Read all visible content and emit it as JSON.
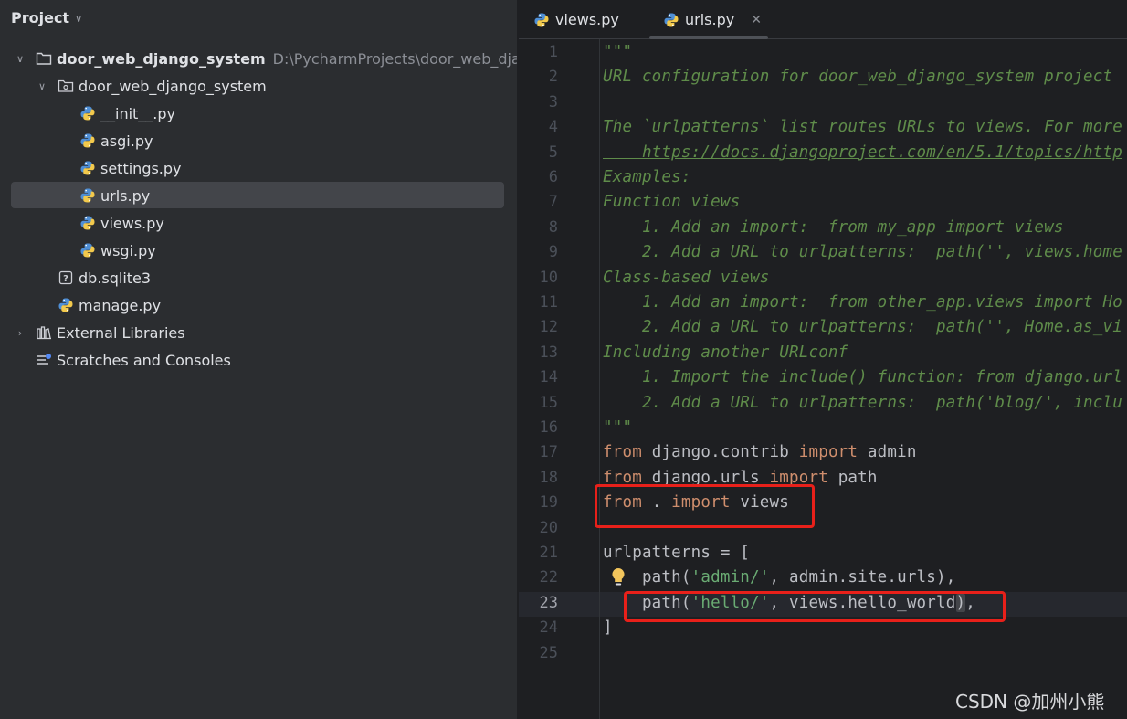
{
  "project_panel": {
    "title": "Project",
    "tree": [
      {
        "label": "door_web_django_system",
        "path": "D:\\PycharmProjects\\door_web_django",
        "icon": "folder-icon",
        "expanded": true
      },
      {
        "label": "door_web_django_system",
        "icon": "package-folder-icon",
        "expanded": true
      },
      {
        "label": "__init__.py",
        "icon": "python-file-icon"
      },
      {
        "label": "asgi.py",
        "icon": "python-file-icon"
      },
      {
        "label": "settings.py",
        "icon": "python-file-icon"
      },
      {
        "label": "urls.py",
        "icon": "python-file-icon",
        "selected": true
      },
      {
        "label": "views.py",
        "icon": "python-file-icon"
      },
      {
        "label": "wsgi.py",
        "icon": "python-file-icon"
      },
      {
        "label": "db.sqlite3",
        "icon": "unknown-file-icon"
      },
      {
        "label": "manage.py",
        "icon": "python-file-icon"
      },
      {
        "label": "External Libraries",
        "icon": "library-icon",
        "expanded": false
      },
      {
        "label": "Scratches and Consoles",
        "icon": "scratches-icon"
      }
    ]
  },
  "editor": {
    "tabs": [
      {
        "label": "views.py",
        "active": false
      },
      {
        "label": "urls.py",
        "active": true
      }
    ],
    "current_line": 23,
    "lines": [
      {
        "n": "1",
        "t": "\"\"\""
      },
      {
        "n": "2",
        "t": "URL configuration for door_web_django_system project"
      },
      {
        "n": "3",
        "t": ""
      },
      {
        "n": "4",
        "t": "The `urlpatterns` list routes URLs to views. For more"
      },
      {
        "n": "5",
        "t": "    https://docs.djangoproject.com/en/5.1/topics/http"
      },
      {
        "n": "6",
        "t": "Examples:"
      },
      {
        "n": "7",
        "t": "Function views"
      },
      {
        "n": "8",
        "t": "    1. Add an import:  from my_app import views"
      },
      {
        "n": "9",
        "t": "    2. Add a URL to urlpatterns:  path('', views.home"
      },
      {
        "n": "10",
        "t": "Class-based views"
      },
      {
        "n": "11",
        "t": "    1. Add an import:  from other_app.views import Ho"
      },
      {
        "n": "12",
        "t": "    2. Add a URL to urlpatterns:  path('', Home.as_vi"
      },
      {
        "n": "13",
        "t": "Including another URLconf"
      },
      {
        "n": "14",
        "t": "    1. Import the include() function: from django.url"
      },
      {
        "n": "15",
        "t": "    2. Add a URL to urlpatterns:  path('blog/', inclu"
      },
      {
        "n": "16",
        "t": "\"\"\""
      },
      {
        "n": "17",
        "kw1": "from",
        "a": " django.contrib ",
        "kw2": "import",
        "b": " admin"
      },
      {
        "n": "18",
        "kw1": "from",
        "a": " django.urls ",
        "kw2": "import",
        "b": " path"
      },
      {
        "n": "19",
        "kw1": "from",
        "a": " . ",
        "kw2": "import",
        "b": " views"
      },
      {
        "n": "20",
        "t": ""
      },
      {
        "n": "21",
        "p": "urlpatterns = ["
      },
      {
        "n": "22",
        "p1": "    path(",
        "s": "'admin/'",
        "p2": ", admin.site.urls),"
      },
      {
        "n": "23",
        "p1": "    path(",
        "s": "'hello/'",
        "p2": ", views.hello_world",
        "p3": ")",
        "p4": ","
      },
      {
        "n": "24",
        "p": "]"
      },
      {
        "n": "25",
        "t": ""
      }
    ]
  },
  "watermark": "CSDN @加州小熊",
  "colors": {
    "highlight_box": "#e8201a",
    "keyword": "#cf8e6d",
    "string": "#6aab73",
    "docstring": "#5f8c4a"
  }
}
